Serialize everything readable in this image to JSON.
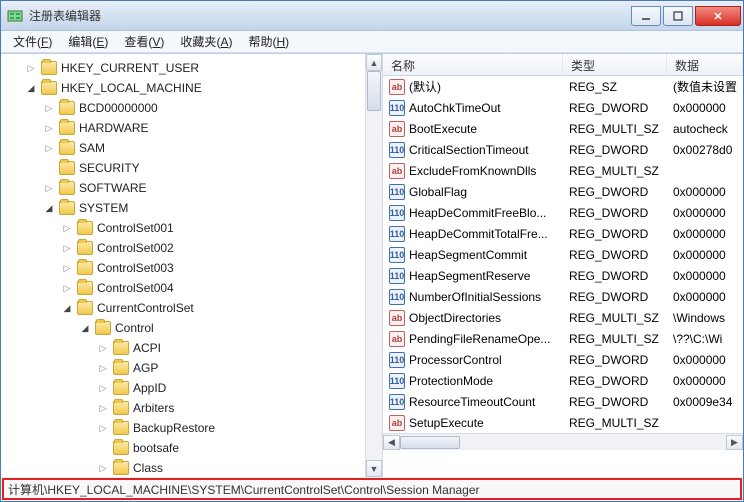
{
  "window": {
    "title": "注册表编辑器"
  },
  "menus": {
    "file": {
      "label": "文件",
      "accel": "F"
    },
    "edit": {
      "label": "编辑",
      "accel": "E"
    },
    "view": {
      "label": "查看",
      "accel": "V"
    },
    "favorites": {
      "label": "收藏夹",
      "accel": "A"
    },
    "help": {
      "label": "帮助",
      "accel": "H"
    }
  },
  "columns": {
    "name": "名称",
    "type": "类型",
    "data": "数据"
  },
  "tree": [
    {
      "depth": 1,
      "twisty": "collapsed",
      "label": "HKEY_CURRENT_USER"
    },
    {
      "depth": 1,
      "twisty": "expanded",
      "label": "HKEY_LOCAL_MACHINE"
    },
    {
      "depth": 2,
      "twisty": "collapsed",
      "label": "BCD00000000"
    },
    {
      "depth": 2,
      "twisty": "collapsed",
      "label": "HARDWARE"
    },
    {
      "depth": 2,
      "twisty": "collapsed",
      "label": "SAM"
    },
    {
      "depth": 2,
      "twisty": "none",
      "label": "SECURITY"
    },
    {
      "depth": 2,
      "twisty": "collapsed",
      "label": "SOFTWARE"
    },
    {
      "depth": 2,
      "twisty": "expanded",
      "label": "SYSTEM"
    },
    {
      "depth": 3,
      "twisty": "collapsed",
      "label": "ControlSet001"
    },
    {
      "depth": 3,
      "twisty": "collapsed",
      "label": "ControlSet002"
    },
    {
      "depth": 3,
      "twisty": "collapsed",
      "label": "ControlSet003"
    },
    {
      "depth": 3,
      "twisty": "collapsed",
      "label": "ControlSet004"
    },
    {
      "depth": 3,
      "twisty": "expanded",
      "label": "CurrentControlSet"
    },
    {
      "depth": 4,
      "twisty": "expanded",
      "label": "Control"
    },
    {
      "depth": 5,
      "twisty": "collapsed",
      "label": "ACPI"
    },
    {
      "depth": 5,
      "twisty": "collapsed",
      "label": "AGP"
    },
    {
      "depth": 5,
      "twisty": "collapsed",
      "label": "AppID"
    },
    {
      "depth": 5,
      "twisty": "collapsed",
      "label": "Arbiters"
    },
    {
      "depth": 5,
      "twisty": "collapsed",
      "label": "BackupRestore"
    },
    {
      "depth": 5,
      "twisty": "none",
      "label": "bootsafe"
    },
    {
      "depth": 5,
      "twisty": "collapsed",
      "label": "Class"
    }
  ],
  "values": [
    {
      "icon": "str",
      "name": "(默认)",
      "type": "REG_SZ",
      "data": "(数值未设置"
    },
    {
      "icon": "bin",
      "name": "AutoChkTimeOut",
      "type": "REG_DWORD",
      "data": "0x000000"
    },
    {
      "icon": "str",
      "name": "BootExecute",
      "type": "REG_MULTI_SZ",
      "data": "autocheck"
    },
    {
      "icon": "bin",
      "name": "CriticalSectionTimeout",
      "type": "REG_DWORD",
      "data": "0x00278d0"
    },
    {
      "icon": "str",
      "name": "ExcludeFromKnownDlls",
      "type": "REG_MULTI_SZ",
      "data": ""
    },
    {
      "icon": "bin",
      "name": "GlobalFlag",
      "type": "REG_DWORD",
      "data": "0x000000"
    },
    {
      "icon": "bin",
      "name": "HeapDeCommitFreeBlo...",
      "type": "REG_DWORD",
      "data": "0x000000"
    },
    {
      "icon": "bin",
      "name": "HeapDeCommitTotalFre...",
      "type": "REG_DWORD",
      "data": "0x000000"
    },
    {
      "icon": "bin",
      "name": "HeapSegmentCommit",
      "type": "REG_DWORD",
      "data": "0x000000"
    },
    {
      "icon": "bin",
      "name": "HeapSegmentReserve",
      "type": "REG_DWORD",
      "data": "0x000000"
    },
    {
      "icon": "bin",
      "name": "NumberOfInitialSessions",
      "type": "REG_DWORD",
      "data": "0x000000"
    },
    {
      "icon": "str",
      "name": "ObjectDirectories",
      "type": "REG_MULTI_SZ",
      "data": "\\Windows"
    },
    {
      "icon": "str",
      "name": "PendingFileRenameOpe...",
      "type": "REG_MULTI_SZ",
      "data": "\\??\\C:\\Wi"
    },
    {
      "icon": "bin",
      "name": "ProcessorControl",
      "type": "REG_DWORD",
      "data": "0x000000"
    },
    {
      "icon": "bin",
      "name": "ProtectionMode",
      "type": "REG_DWORD",
      "data": "0x000000"
    },
    {
      "icon": "bin",
      "name": "ResourceTimeoutCount",
      "type": "REG_DWORD",
      "data": "0x0009e34"
    },
    {
      "icon": "str",
      "name": "SetupExecute",
      "type": "REG_MULTI_SZ",
      "data": ""
    }
  ],
  "statusbar": {
    "path": "计算机\\HKEY_LOCAL_MACHINE\\SYSTEM\\CurrentControlSet\\Control\\Session Manager"
  },
  "icons": {
    "str_label": "ab",
    "bin_label": "110"
  }
}
